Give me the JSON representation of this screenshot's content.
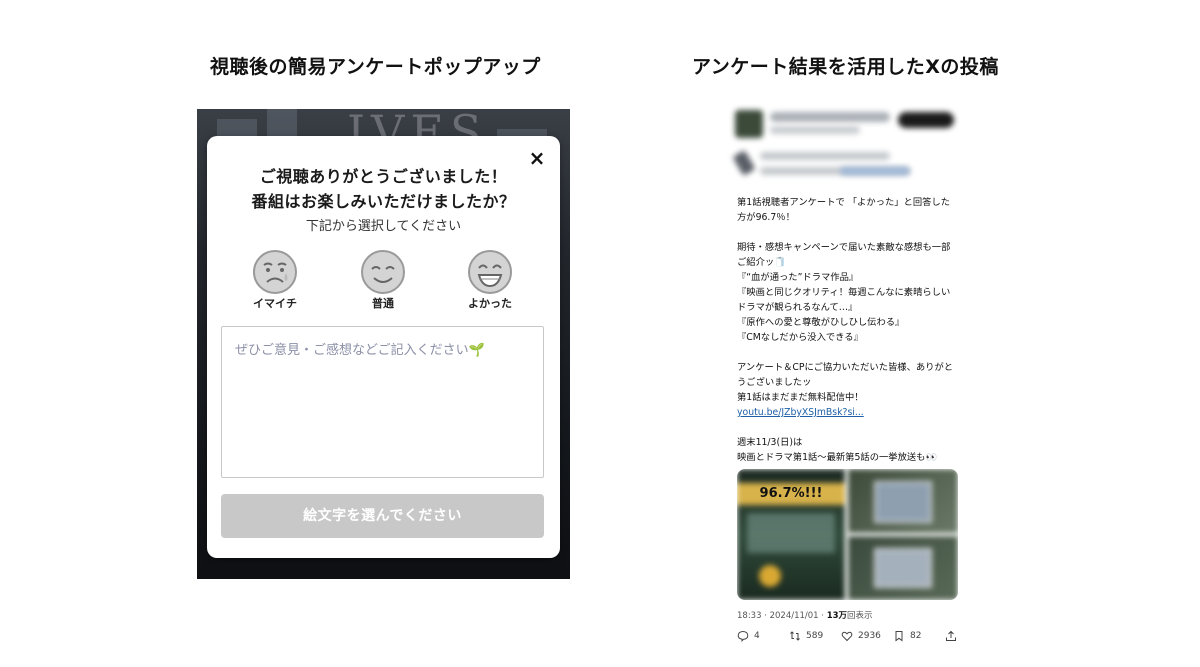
{
  "headings": {
    "left": "視聴後の簡易アンケートポップアップ",
    "right": "アンケート結果を活用したXの投稿"
  },
  "popup": {
    "close_label": "×",
    "title_line1": "ご視聴ありがとうございました！",
    "title_line2": "番組はお楽しみいただけましたか？",
    "subtitle": "下記から選択してください",
    "faces": [
      {
        "label": "イマイチ",
        "icon": "sad-face-icon"
      },
      {
        "label": "普通",
        "icon": "neutral-face-icon"
      },
      {
        "label": "よかった",
        "icon": "happy-face-icon"
      }
    ],
    "comment_placeholder": "ぜひご意見・ご感想などご記入ください",
    "submit_label": "絵文字を選んでください"
  },
  "tweet": {
    "lines": [
      "第1話視聴者アンケートで 「よかった」と回答した",
      "方が96.7％！",
      "",
      "期待・感想キャンペーンで届いた素敵な感想も一部",
      "ご紹介ッ🧻",
      "『“血が通った”ドラマ作品』",
      "『映画と同じクオリティ！毎週こんなに素晴らしい",
      "ドラマが観られるなんて…』",
      "『原作への愛と尊敬がひしひし伝わる』",
      "『CMなしだから没入できる』",
      "",
      "アンケート＆CPにご協力いただいた皆様、ありがと",
      "うございましたッ",
      "第1話はまだまだ無料配信中！"
    ],
    "link": "youtu.be/JZbyXSJmBsk?si...",
    "lines_after": [
      "週末11/3(日)は",
      "映画とドラマ第1話〜最新第5話の一挙放送も👀"
    ],
    "media_badge": "96.7%!!!",
    "timestamp": "18:33 · 2024/11/01 · ",
    "views_count": "13万",
    "views_label": "回表示",
    "actions": {
      "reply": "4",
      "retweet": "589",
      "like": "2936",
      "bookmark": "82"
    }
  }
}
